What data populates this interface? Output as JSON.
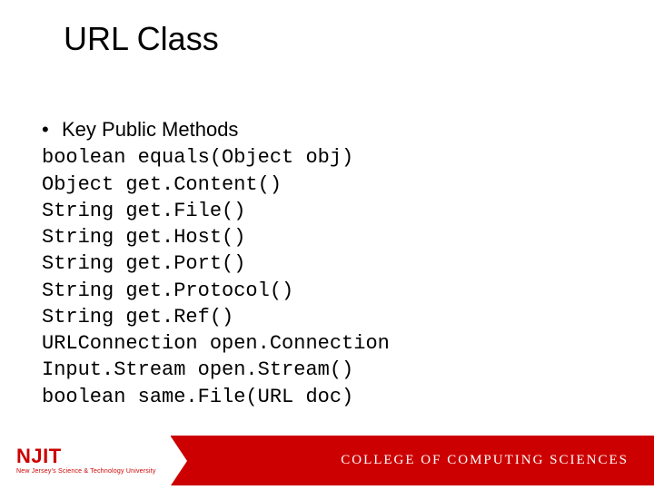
{
  "title": "URL Class",
  "bullet_label": "Key Public Methods",
  "code_lines": [
    "boolean equals(Object obj)",
    "Object get.Content()",
    "String get.File()",
    "String get.Host()",
    "String get.Port()",
    "String get.Protocol()",
    "String get.Ref()",
    "URLConnection open.Connection",
    "Input.Stream open.Stream()",
    "boolean same.File(URL doc)"
  ],
  "footer": {
    "logo_main": "NJIT",
    "logo_sub": "New Jersey's Science & Technology University",
    "college": "COLLEGE OF COMPUTING SCIENCES"
  }
}
